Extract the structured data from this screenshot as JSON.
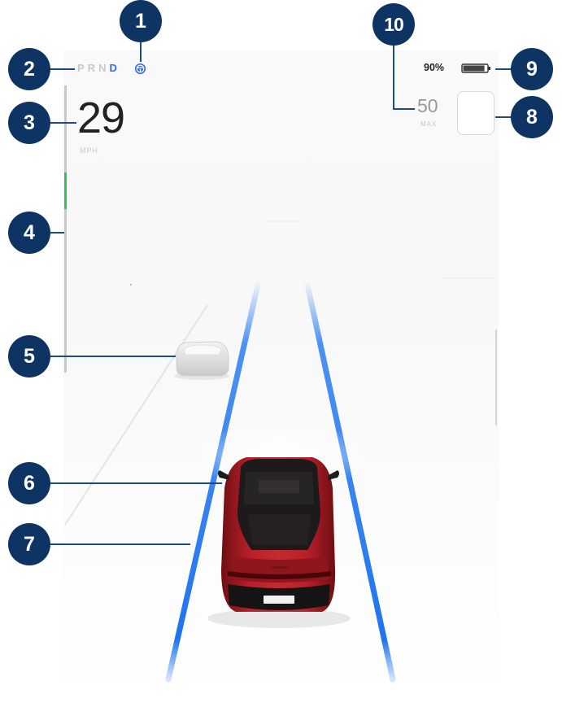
{
  "display": {
    "gear": {
      "letters": [
        "P",
        "R",
        "N",
        "D"
      ],
      "selected": "D"
    },
    "speed": {
      "value": "29",
      "unit": "MPH"
    },
    "power_meter": {
      "regen_level": 0.13
    },
    "battery": {
      "percent": "90%",
      "level": 0.9
    },
    "speed_limit": {
      "value": "50",
      "label": "MAX"
    }
  },
  "callouts": [
    "1",
    "2",
    "3",
    "4",
    "5",
    "6",
    "7",
    "8",
    "9",
    "10"
  ],
  "colors": {
    "autopilot_blue": "#2f6ee8",
    "lane_blue": "#2d7ff0",
    "regen_green": "#32c25b",
    "vehicle_red": "#a8191f",
    "callout_navy": "#0e3464"
  },
  "icons": {
    "autopilot": "steering-wheel-icon",
    "battery": "battery-icon",
    "speed_limit_sign": "speed-limit-sign-icon"
  }
}
